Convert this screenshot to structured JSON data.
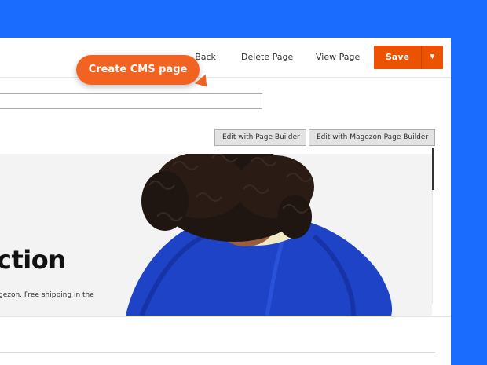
{
  "toolbar": {
    "back_label": "Back",
    "back_icon": "arrow-left-icon",
    "delete_label": "Delete Page",
    "view_label": "View Page",
    "save_label": "Save",
    "save_caret": "▼"
  },
  "form": {
    "title_value": ""
  },
  "page_builder": {
    "edit_pb_label": "Edit with Page Builder",
    "edit_magezon_label": "Edit with Magezon Page Builder"
  },
  "callout": {
    "label": "Create CMS page"
  },
  "banner": {
    "heading": "ction",
    "text": "gezon. Free shipping in the"
  },
  "colors": {
    "background": "#1a6bff",
    "accent": "#eb5202",
    "callout": "#f26322"
  }
}
